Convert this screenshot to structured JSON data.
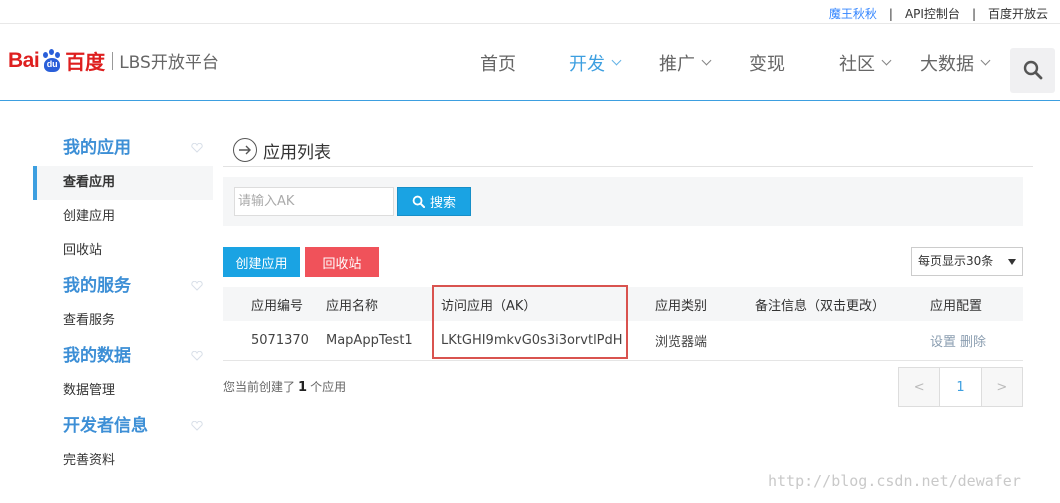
{
  "topbar": {
    "user": "魔王秋秋",
    "console": "API控制台",
    "cloud": "百度开放云"
  },
  "brand": {
    "bai": "Bai",
    "du": "du",
    "cn": "百度",
    "product": "LBS开放平台",
    "colors": {
      "red": "#de1f1f",
      "blue": "#2a5fd9"
    }
  },
  "nav": {
    "items": [
      {
        "label": "首页",
        "dropdown": false,
        "active": false
      },
      {
        "label": "开发",
        "dropdown": true,
        "active": true
      },
      {
        "label": "推广",
        "dropdown": true,
        "active": false
      },
      {
        "label": "变现",
        "dropdown": false,
        "active": false
      },
      {
        "label": "社区",
        "dropdown": true,
        "active": false
      },
      {
        "label": "大数据",
        "dropdown": true,
        "active": false
      }
    ],
    "search_icon": "search-icon"
  },
  "sidebar": {
    "groups": [
      {
        "title": "我的应用",
        "items": [
          "查看应用",
          "创建应用",
          "回收站"
        ]
      },
      {
        "title": "我的服务",
        "items": [
          "查看服务"
        ]
      },
      {
        "title": "我的数据",
        "items": [
          "数据管理"
        ]
      },
      {
        "title": "开发者信息",
        "items": [
          "完善资料"
        ]
      }
    ],
    "active_item": "查看应用"
  },
  "main": {
    "title": "应用列表",
    "search": {
      "placeholder": "请输入AK",
      "value": "",
      "button": "搜索"
    },
    "buttons": {
      "create": "创建应用",
      "recycle": "回收站"
    },
    "per_page": "每页显示30条",
    "table": {
      "headers": [
        "应用编号",
        "应用名称",
        "访问应用（AK）",
        "应用类别",
        "备注信息（双击更改）",
        "应用配置"
      ],
      "rows": [
        {
          "id": "5071370",
          "name": "MapAppTest1",
          "ak": "LKtGHI9mkvG0s3i3orvtlPdH",
          "type": "浏览器端",
          "note": "",
          "ops": [
            "设置",
            "删除"
          ]
        }
      ]
    },
    "summary": {
      "prefix": "您当前创建了",
      "count": "1",
      "suffix": "个应用"
    },
    "pager": {
      "prev": "<",
      "current": "1",
      "next": ">"
    }
  },
  "watermark": "http://blog.csdn.net/dewafer",
  "colors": {
    "accent": "#3d9fe0",
    "danger": "#f0525a",
    "highlight_box": "#d9534f"
  }
}
